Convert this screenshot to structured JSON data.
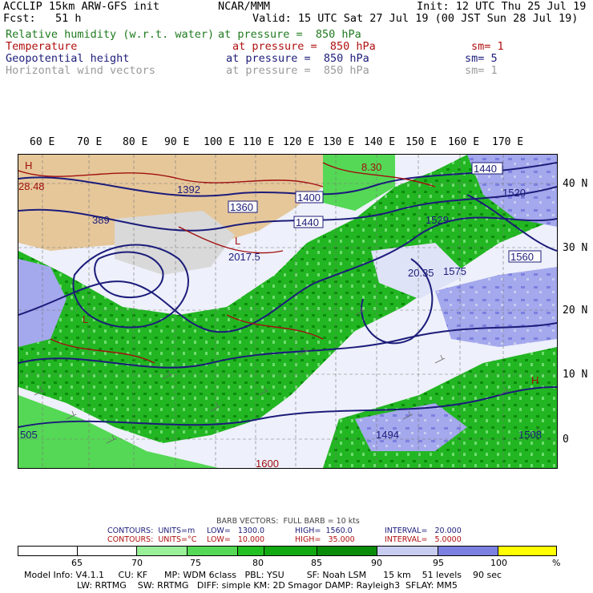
{
  "header": {
    "line1_left": "ACCLIP 15km ARW-GFS init",
    "line1_mid": "NCAR/MMM",
    "line1_right": "Init: 12 UTC Thu 25 Jul 19",
    "line2_left": "Fcst:   51 h",
    "line2_right": "Valid: 15 UTC Sat 27 Jul 19 (00 JST Sun 28 Jul 19)"
  },
  "fields": [
    {
      "name": "Relative humidity (w.r.t. water)",
      "pressure": "at pressure =  850 hPa",
      "sm": "",
      "color": "#1f7a1f"
    },
    {
      "name": "Temperature",
      "pressure": "at pressure =  850 hPa",
      "sm": "sm= 1",
      "color": "#b01010"
    },
    {
      "name": "Geopotential height",
      "pressure": "at pressure =  850 hPa",
      "sm": "sm= 5",
      "color": "#1c1c7a"
    },
    {
      "name": "Horizontal wind vectors",
      "pressure": "at pressure =  850 hPa",
      "sm": "sm= 1",
      "color": "#9a9a9a"
    }
  ],
  "lon_labels": [
    "60 E",
    "70 E",
    "80 E",
    "90 E",
    "100 E",
    "110 E",
    "120 E",
    "130 E",
    "140 E",
    "150 E",
    "160 E",
    "170 E"
  ],
  "lat_labels": [
    "40 N",
    "30 N",
    "20 N",
    "10 N",
    "0"
  ],
  "map_labels": [
    "28.48",
    "389",
    "1392",
    "H",
    "L",
    "2017.5",
    "1400",
    "1440",
    "1360",
    "1520",
    "1560",
    "1440",
    "1529",
    "8.30",
    "1575",
    "20.35",
    "1494",
    "1508",
    "505",
    "L",
    "H",
    "1600"
  ],
  "barb_note": "BARB VECTORS:  FULL BARB = 10 kts",
  "contours": [
    {
      "label": "CONTOURS:  UNITS=m",
      "low": "LOW=   1300.0",
      "high": "HIGH=  1560.0",
      "interval": "INTERVAL=   20.000",
      "color": "#1c1c7a"
    },
    {
      "label": "CONTOURS:  UNITS=°C",
      "low": "LOW=   10.000",
      "high": "HIGH=   35.000",
      "interval": "INTERVAL=   5.0000",
      "color": "#b01010"
    }
  ],
  "colorbar": {
    "ticks": [
      "65",
      "70",
      "75",
      "80",
      "85",
      "90",
      "95",
      "100",
      "%"
    ],
    "colors": [
      "#ffffff",
      "#ffffff",
      "#99f099",
      "#55d855",
      "#22c022",
      "#12a812",
      "#0a8c0a",
      "#c8ccf0",
      "#a4a8ec",
      "#7c80e0",
      "#ffff00"
    ]
  },
  "footer": {
    "line1": "Model Info: V4.1.1     CU: KF      MP: WDM 6class   PBL: YSU        SF: Noah LSM      15 km    51 levels    90 sec",
    "line2": "LW: RRTMG    SW: RRTMG   DIFF: simple KM: 2D Smagor DAMP: Rayleigh3  SFLAY: MM5"
  }
}
